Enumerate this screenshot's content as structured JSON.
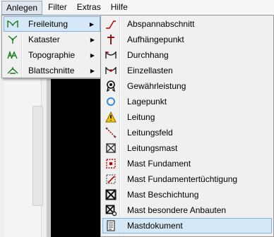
{
  "menubar": {
    "items": [
      {
        "label": "Anlegen"
      },
      {
        "label": "Filter"
      },
      {
        "label": "Extras"
      },
      {
        "label": "Hilfe"
      }
    ]
  },
  "menu_anlegen": {
    "items": [
      {
        "label": "Freileitung",
        "icon": "freileitung-icon"
      },
      {
        "label": "Kataster",
        "icon": "kataster-icon"
      },
      {
        "label": "Topographie",
        "icon": "topographie-icon"
      },
      {
        "label": "Blattschnitte",
        "icon": "blattschnitte-icon"
      }
    ],
    "submenu_arrow": "▶"
  },
  "menu_freileitung": {
    "items": [
      {
        "label": "Abspannabschnitt"
      },
      {
        "label": "Aufhängepunkt"
      },
      {
        "label": "Durchhang"
      },
      {
        "label": "Einzellasten"
      },
      {
        "label": "Gewährleistung"
      },
      {
        "label": "Lagepunkt"
      },
      {
        "label": "Leitung"
      },
      {
        "label": "Leitungsfeld"
      },
      {
        "label": "Leitungsmast"
      },
      {
        "label": "Mast Fundament"
      },
      {
        "label": "Mast Fundamentertüchtigung"
      },
      {
        "label": "Mast Beschichtung"
      },
      {
        "label": "Mast besondere Anbauten"
      },
      {
        "label": "Mastdokument"
      }
    ]
  },
  "colors": {
    "highlight": "#d5e8f8",
    "highlight_border": "#7fb2e0",
    "menu_bg": "#f0f0f0",
    "icon_green": "#1a7a1a",
    "icon_red": "#c00000"
  }
}
